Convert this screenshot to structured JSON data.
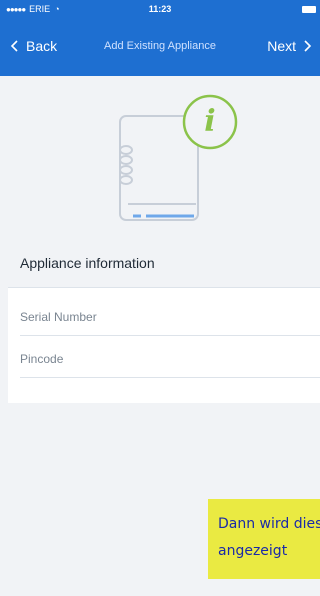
{
  "status_bar": {
    "carrier": "ERIE",
    "time": "11:23"
  },
  "nav": {
    "back_label": "Back",
    "title": "Add Existing Appliance",
    "next_label": "Next"
  },
  "illustration": {
    "badge_letter": "i"
  },
  "section": {
    "title": "Appliance information"
  },
  "form": {
    "serial_placeholder": "Serial Number",
    "pincode_placeholder": "Pincode"
  },
  "note": {
    "line1": "Dann wird dies",
    "line2": "angezeigt"
  },
  "colors": {
    "header": "#1e6fd1",
    "accent_green": "#8bc34a",
    "note_bg": "#eaea42",
    "note_text": "#1a2aa8"
  }
}
